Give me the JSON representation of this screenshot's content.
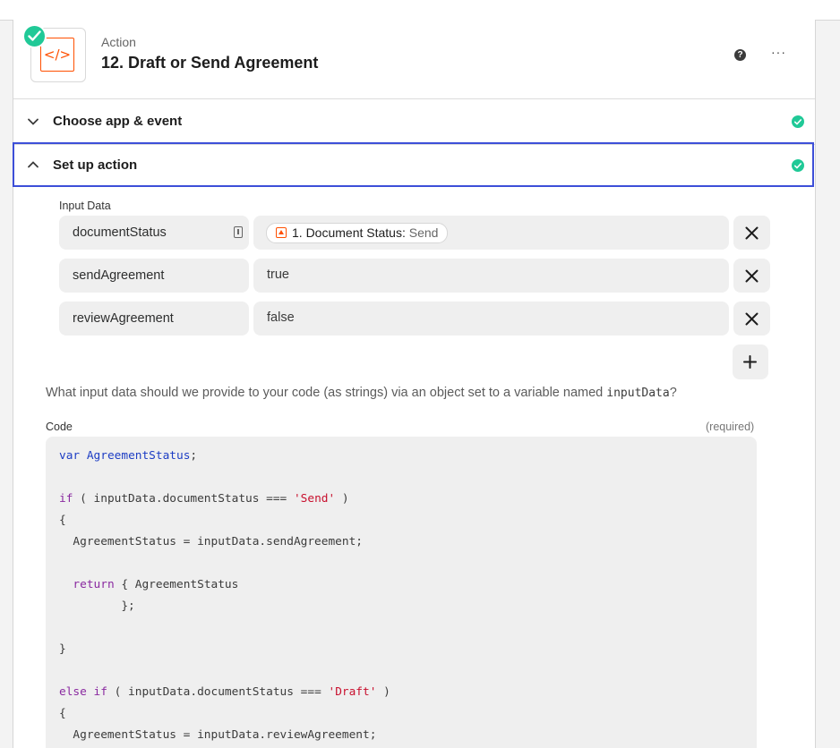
{
  "header": {
    "subtitle": "Action",
    "title": "12. Draft or Send Agreement",
    "app_icon": "code-brackets-icon",
    "app_icon_glyph": "</>",
    "help_glyph": "?",
    "more_glyph": "···"
  },
  "sections": {
    "choose_app": {
      "label": "Choose app & event",
      "state": "collapsed",
      "complete": true
    },
    "setup_action": {
      "label": "Set up action",
      "state": "expanded",
      "complete": true
    }
  },
  "input_data": {
    "label": "Input Data",
    "rows": [
      {
        "key": "documentStatus",
        "value_pill": {
          "label": "1. Document Status:",
          "value": "Send"
        }
      },
      {
        "key": "sendAgreement",
        "value": "true"
      },
      {
        "key": "reviewAgreement",
        "value": "false"
      }
    ],
    "help_text_prefix": "What input data should we provide to your code (as strings) via an object set to a variable named ",
    "help_text_code": "inputData",
    "help_text_suffix": "?"
  },
  "code": {
    "label": "Code",
    "required_label": "(required)",
    "lines": [
      "var AgreementStatus;",
      "",
      "if ( inputData.documentStatus === 'Send' )",
      "{",
      "  AgreementStatus = inputData.sendAgreement;",
      "",
      "  return { AgreementStatus",
      "         };",
      "",
      "}",
      "",
      "else if ( inputData.documentStatus === 'Draft' )",
      "{",
      "  AgreementStatus = inputData.reviewAgreement;"
    ]
  },
  "colors": {
    "accent_orange": "#ff4f00",
    "success_green": "#20c997",
    "focus_blue": "#3d4fd8"
  }
}
